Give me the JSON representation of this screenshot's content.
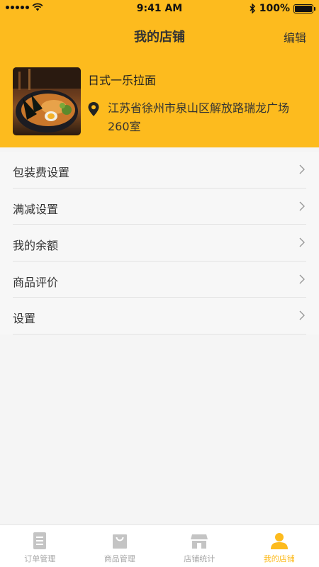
{
  "status_bar": {
    "time": "9:41 AM",
    "battery": "100%",
    "battery_level": 1.0
  },
  "nav": {
    "title": "我的店铺",
    "edit": "编辑"
  },
  "shop": {
    "name": "日式一乐拉面",
    "address": "江苏省徐州市泉山区解放路瑞龙广场260室"
  },
  "menu": [
    {
      "label": "包装费设置"
    },
    {
      "label": "满减设置"
    },
    {
      "label": "我的余额"
    },
    {
      "label": "商品评价"
    },
    {
      "label": "设置"
    }
  ],
  "tabs": [
    {
      "label": "订单管理",
      "icon": "order-list-icon"
    },
    {
      "label": "商品管理",
      "icon": "shopping-bag-icon"
    },
    {
      "label": "店铺统计",
      "icon": "storefront-icon"
    },
    {
      "label": "我的店铺",
      "icon": "user-icon",
      "active": true
    }
  ],
  "colors": {
    "accent": "#fdbb1e",
    "inactive": "#a8a8a8"
  }
}
